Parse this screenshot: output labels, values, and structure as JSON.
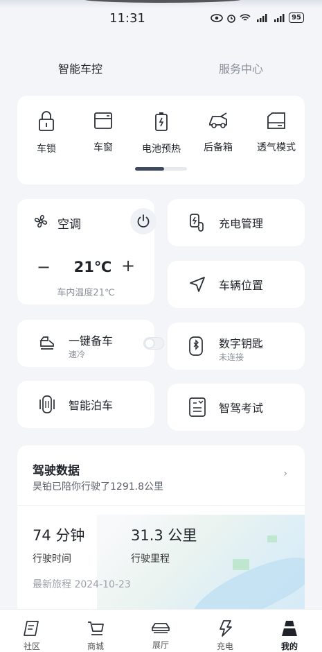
{
  "status_bar": {
    "time": "11:31",
    "battery": "95"
  },
  "tabs": [
    {
      "label": "智能车控"
    },
    {
      "label": "服务中心"
    }
  ],
  "quick_controls": [
    {
      "label": "车锁",
      "icon": "lock-icon"
    },
    {
      "label": "车窗",
      "icon": "window-icon"
    },
    {
      "label": "电池预热",
      "icon": "battery-icon"
    },
    {
      "label": "后备箱",
      "icon": "trunk-icon"
    },
    {
      "label": "透气模式",
      "icon": "vent-icon"
    }
  ],
  "ac": {
    "title": "空调",
    "minus": "−",
    "temperature": "21℃",
    "plus": "+",
    "inside_temp": "车内温度21℃"
  },
  "features": {
    "charge": "充电管理",
    "location": "车辆位置",
    "prep": {
      "title": "一键备车",
      "sub": "速冷"
    },
    "digital_key": {
      "title": "数字钥匙",
      "sub": "未连接"
    },
    "parking": "智能泊车",
    "exam": "智驾考试"
  },
  "driving": {
    "title": "驾驶数据",
    "subtitle": "昊铂已陪你行驶了1291.8公里",
    "chevron": "›",
    "time_value": "74 分钟",
    "time_label": "行驶时间",
    "distance_value": "31.3 公里",
    "distance_label": "行驶里程",
    "latest": "最新旅程 2024-10-23"
  },
  "bottom_nav": [
    {
      "label": "社区",
      "icon": "community-icon"
    },
    {
      "label": "商城",
      "icon": "cart-icon"
    },
    {
      "label": "展厅",
      "icon": "car-icon"
    },
    {
      "label": "充电",
      "icon": "bolt-icon"
    },
    {
      "label": "我的",
      "icon": "profile-icon"
    }
  ],
  "colors": {
    "background": "#f3f5f8",
    "card": "#ffffff",
    "accent": "#3d4a5e",
    "muted": "#8a8f99"
  }
}
